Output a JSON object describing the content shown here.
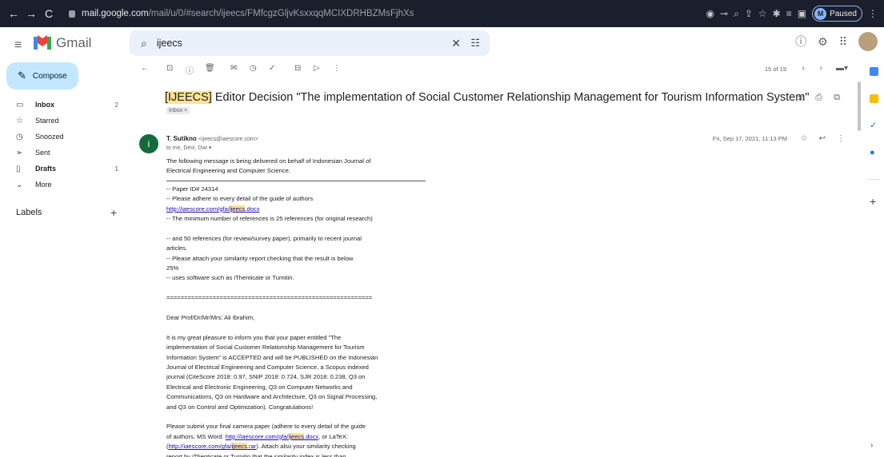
{
  "browser": {
    "url_host": "mail.google.com",
    "url_path": "/mail/u/0/#search/ijeecs/FMfcgzGljvKsxxqqMCIXDRHBZMsFjhXs",
    "profile_initial": "M",
    "profile_status": "Paused"
  },
  "app": {
    "name": "Gmail",
    "search_value": "ijeecs"
  },
  "sidebar": {
    "compose": "Compose",
    "items": [
      {
        "label": "Inbox",
        "count": "2"
      },
      {
        "label": "Starred",
        "count": ""
      },
      {
        "label": "Snoozed",
        "count": ""
      },
      {
        "label": "Sent",
        "count": ""
      },
      {
        "label": "Drafts",
        "count": "1"
      },
      {
        "label": "More",
        "count": ""
      }
    ],
    "labels_heading": "Labels"
  },
  "toolbar": {
    "pager": "15 of 19"
  },
  "email": {
    "subject_tag": "IJEECS",
    "subject_rest": "Editor Decision \"The implementation of Social Customer Relationship Management for Tourism Information System\"",
    "label_chip": "Inbox ×",
    "sender_initial": "i",
    "sender_name": "T. Sutikno",
    "sender_email": "<ijeecs@iaescore.com>",
    "to": "to me, Devi, Dwi",
    "date": "Fri, Sep 17, 2021, 11:13 PM",
    "body": {
      "intro1": "The following message is being delivered on behalf of Indonesian Journal of",
      "intro2": "Electrical Engineering and Computer Science.",
      "paper_id": "-- Paper ID# 24314",
      "guide": "-- Please adhere to every detail of the guide of authors",
      "link1_pre": "http://iaescore.com/gfa/",
      "link1_hl": "ijeecs",
      "link1_post": ".docx",
      "min_refs": "-- The minimum number of references is 25 references (for original research)",
      "refs50a": "-- and 50 references (for review/survey paper), primarily to recent journal",
      "refs50b": "articles.",
      "sim1": "-- Please attach your similarity report checking that the result is below",
      "sim2": "25%",
      "sim3": "-- uses software such as iThenticate or Turnitin.",
      "equals": "==========================================================",
      "dear": "Dear Prof/Dr/Mr/Mrs: Ali Ibrahim,",
      "p1": "It is my great pleasure to inform you that your paper entitled \"The",
      "p2": "implementation of Social Customer Relationship Management for Tourism",
      "p3": "Information System\" is ACCEPTED and will be PUBLISHED on the Indonesian",
      "p4": "Journal of Electrical Engineering and Computer Science, a Scopus indexed",
      "p5": "journal (CiteScore 2018: 0.97, SNIP 2018: 0.724, SJR 2018: 0.238, Q3 on",
      "p6": "Electrical and Electronic Engineering, Q3 on Computer Networks and",
      "p7": "Communications, Q3 on Hardware and Architecture, Q3 on Signal Processing,",
      "p8": "and Q3 on Control and Optimization). Congratulations!",
      "s1": "Please submit your final camera paper (adhere to every detail of the guide",
      "s2_pre": "of authors, MS Word: ",
      "s2_post": ", or LaTeX:",
      "link3_pre": "http://iaescore.com/gfa/",
      "link3_hl": "ijeecs",
      "link3_post": ".rar",
      "s3_post": "). Attach also your similarity checking",
      "s4": "report by iThenticate or Turnitin that the similarity index is less than"
    }
  }
}
